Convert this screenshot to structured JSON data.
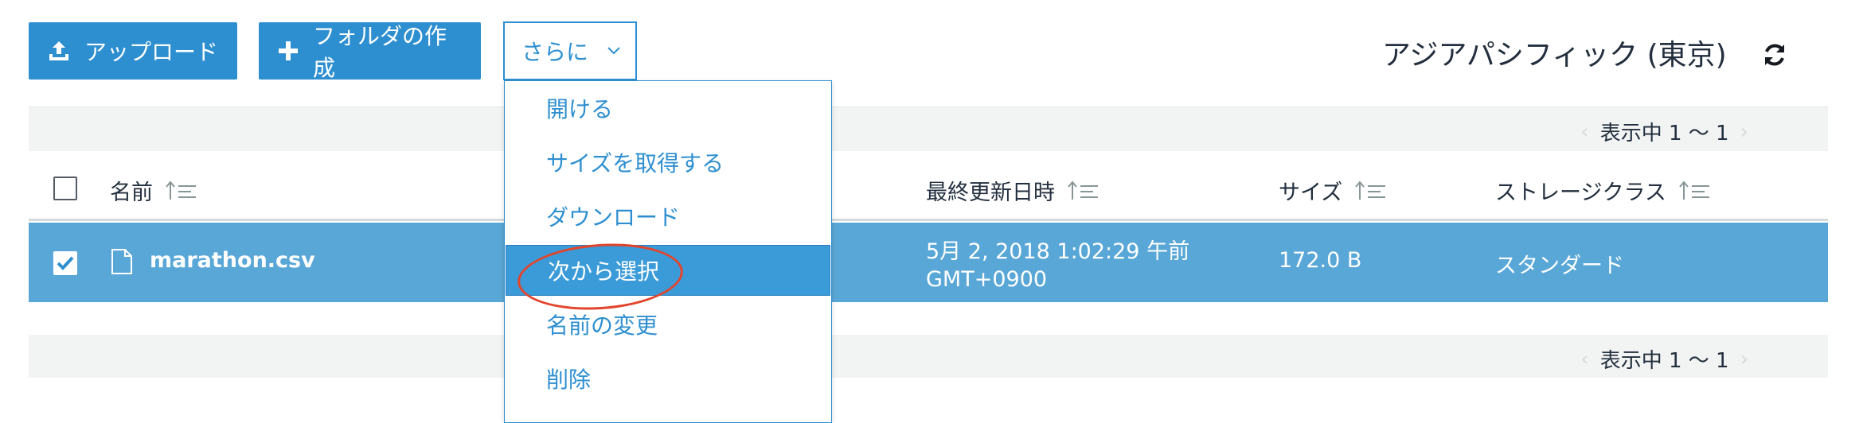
{
  "toolbar": {
    "upload_label": "アップロード",
    "create_folder_label": "フォルダの作成",
    "more_label": "さらに"
  },
  "region": {
    "label": "アジアパシフィック (東京)"
  },
  "pagination": {
    "top_text": "表示中 1 〜 1",
    "bottom_text": "表示中 1 〜 1",
    "prev": "‹",
    "next": "›"
  },
  "table": {
    "columns": [
      "名前",
      "最終更新日時",
      "サイズ",
      "ストレージクラス"
    ],
    "rows": [
      {
        "name": "marathon.csv",
        "modified_line1": "5月 2, 2018 1:02:29 午前",
        "modified_line2": "GMT+0900",
        "size": "172.0 B",
        "storage_class": "スタンダード",
        "selected": true
      }
    ]
  },
  "menu": {
    "items": [
      "開ける",
      "サイズを取得する",
      "ダウンロード",
      "次から選択",
      "名前の変更",
      "削除"
    ],
    "highlighted_index": 3
  },
  "colors": {
    "primary": "#2e8fd0",
    "selected_row": "#59a7d7",
    "menu_highlight": "#3a9bd8",
    "annotation": "#e2452c"
  }
}
